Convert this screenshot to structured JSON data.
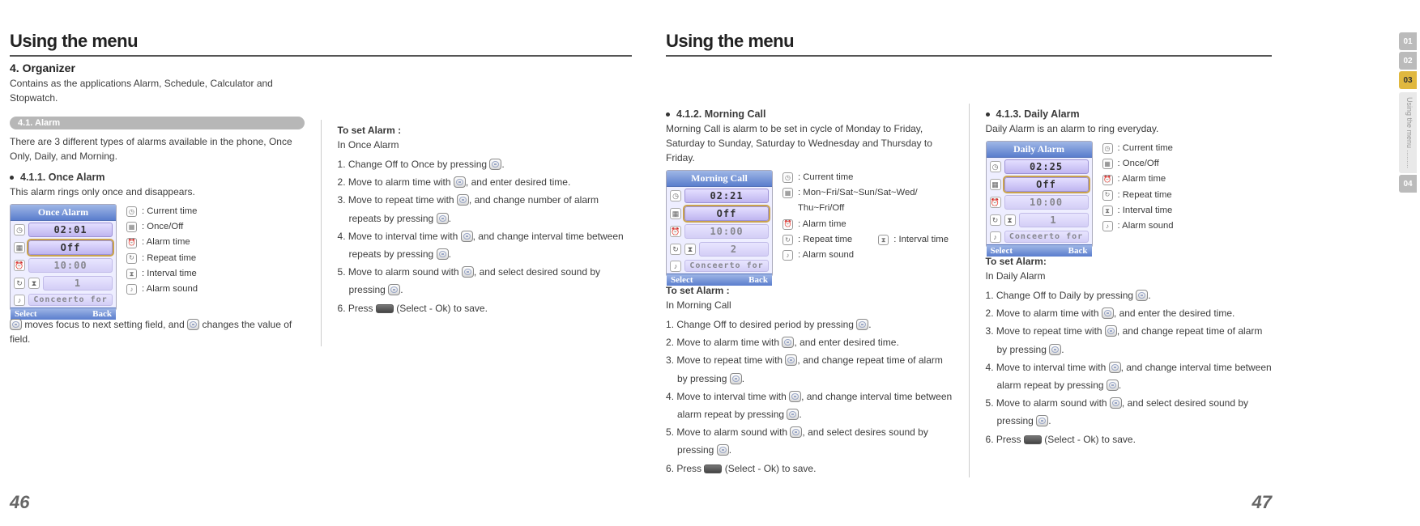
{
  "left": {
    "title": "Using the menu",
    "section_num": "4. Organizer",
    "intro": "Contains as the applications Alarm, Schedule, Calculator and Stopwatch.",
    "badge": "4.1. Alarm",
    "alarm_intro": "There are 3 different types of alarms available in the phone, Once Only, Daily, and Morning.",
    "once": {
      "heading": "4.1.1. Once Alarm",
      "desc": "This alarm rings only once and disappears.",
      "nav_note_a": " moves focus to next setting field, and ",
      "nav_note_b": " changes the value of field."
    },
    "phone1": {
      "title": "Once Alarm",
      "time": "02:01",
      "state": "Off",
      "repeat": "10:00",
      "interval": "1",
      "snd": "Conceerto for",
      "select": "Select",
      "back": "Back"
    },
    "legend1": {
      "a": ": Current time",
      "b": ": Once/Off",
      "c": ": Alarm time",
      "d": ": Repeat time",
      "e": ": Interval time",
      "f": ": Alarm sound"
    },
    "set_heading": "To set Alarm :",
    "set_sub": "In Once Alarm",
    "steps": [
      "Change Off to Once by pressing KEY.",
      "Move to alarm time with KEY, and enter desired time.",
      "Move to repeat time with KEY, and change number of alarm repeats by pressing KEY.",
      "Move to interval time with  KEY, and change interval time between repeats by pressing KEY.",
      "Move to alarm sound with KEY, and select desired sound by pressing KEY.",
      "Press SOFT (Select - Ok) to save."
    ],
    "page_num": "46"
  },
  "right": {
    "title": "Using the menu",
    "morning": {
      "heading": "4.1.2. Morning Call",
      "desc": "Morning Call is alarm to be set in cycle of Monday to Friday, Saturday to Sunday, Saturday to Wednesday and Thursday to Friday."
    },
    "phone2": {
      "title": "Morning Call",
      "time": "02:21",
      "state": "Off",
      "repeat": "10:00",
      "interval": "2",
      "snd": "Conceerto for",
      "select": "Select",
      "back": "Back"
    },
    "legend2": {
      "a": ": Current time",
      "b": ": Mon~Fri/Sat~Sun/Sat~Wed/",
      "b2": "  Thu~Fri/Off",
      "c": ": Alarm time",
      "d": ": Repeat time",
      "e": ": Alarm sound",
      "f": ": Interval time"
    },
    "morning_set_heading": "To set Alarm :",
    "morning_set_sub": "In Morning Call",
    "morning_steps": [
      "Change Off to desired period by pressing KEY.",
      "Move to alarm time with KEY, and enter desired time.",
      "Move to repeat time with KEY, and change repeat time of alarm by pressing KEY.",
      "Move to interval time with KEY, and change interval time between alarm repeat by pressing KEY.",
      "Move to alarm sound with KEY, and select desires sound by pressing  KEY.",
      "Press SOFT (Select - Ok) to save."
    ],
    "daily": {
      "heading": "4.1.3. Daily Alarm",
      "desc": "Daily Alarm is an alarm to ring everyday."
    },
    "phone3": {
      "title": "Daily Alarm",
      "time": "02:25",
      "state": "Off",
      "repeat": "10:00",
      "interval": "1",
      "snd": "Conceerto for",
      "select": "Select",
      "back": "Back"
    },
    "legend3": {
      "a": ": Current time",
      "b": ": Once/Off",
      "c": ": Alarm time",
      "d": ": Repeat time",
      "e": ": Interval time",
      "f": ": Alarm sound"
    },
    "daily_set_heading": "To set Alarm:",
    "daily_set_sub": "In Daily Alarm",
    "daily_steps": [
      "Change Off to Daily by pressing KEY.",
      "Move to alarm time with KEY, and enter the desired time.",
      "Move to repeat time with KEY, and change repeat time of alarm by pressing KEY.",
      "Move to interval time with KEY, and change interval time between alarm repeat by pressing KEY.",
      "Move to alarm sound with KEY, and select desired sound by pressing KEY.",
      "Press SOFT (Select - Ok) to save."
    ],
    "page_num": "47"
  },
  "tabs": {
    "t1": "01",
    "t2": "02",
    "t3": "03",
    "t4": "04",
    "label": "Using the menu ........."
  }
}
